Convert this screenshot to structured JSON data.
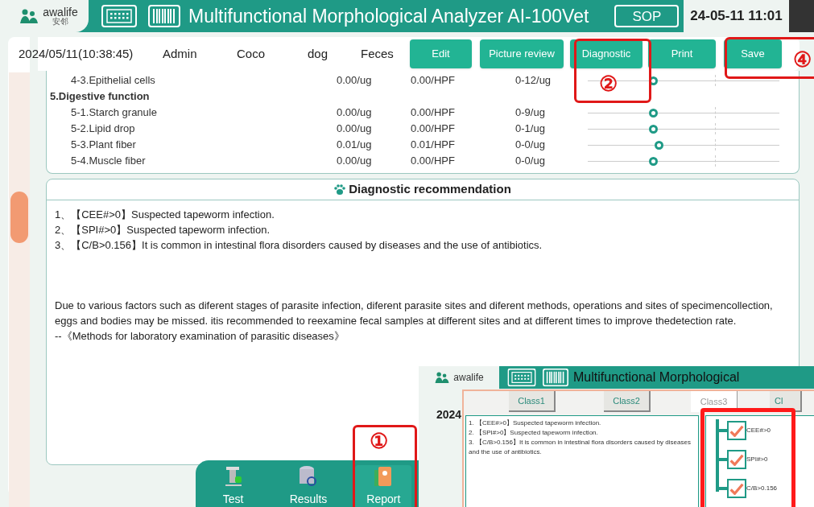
{
  "header": {
    "logo": "awalife",
    "logo_sub": "安邻",
    "title": "Multifunctional Morphological Analyzer AI-100Vet",
    "sop": "SOP",
    "datetime": "24-05-11 11:01"
  },
  "info": {
    "fields": [
      "2024/05/11(10:38:45)",
      "Admin",
      "Coco",
      "dog",
      "Feces"
    ],
    "buttons": [
      "Edit",
      "Picture review",
      "Diagnostic",
      "Print",
      "Save"
    ]
  },
  "table": {
    "rows": [
      {
        "kind": "item",
        "name": "4-3.Epithelial cells",
        "value": "0.00/ug",
        "hpf": "0.00/HPF",
        "range": "0-12/ug",
        "level": 0.34
      },
      {
        "kind": "heading",
        "name": "5.Digestive function"
      },
      {
        "kind": "item",
        "name": "5-1.Starch granule",
        "value": "0.00/ug",
        "hpf": "0.00/HPF",
        "range": "0-9/ug",
        "level": 0.34
      },
      {
        "kind": "item",
        "name": "5-2.Lipid drop",
        "value": "0.00/ug",
        "hpf": "0.00/HPF",
        "range": "0-1/ug",
        "level": 0.34
      },
      {
        "kind": "item",
        "name": "5-3.Plant fiber",
        "value": "0.01/ug",
        "hpf": "0.01/HPF",
        "range": "0-0/ug",
        "level": 0.37
      },
      {
        "kind": "item",
        "name": "5-4.Muscle fiber",
        "value": "0.00/ug",
        "hpf": "0.00/HPF",
        "range": "0-0/ug",
        "level": 0.34
      }
    ]
  },
  "recommendation": {
    "title": "Diagnostic recommendation",
    "items": [
      "1、【CEE#>0】Suspected tapeworm infection.",
      "2、【SPI#>0】Suspected tapeworm infection.",
      "3、【C/B>0.156】It is common in intestinal flora disorders caused by diseases and the use of antibiotics."
    ],
    "note": "Due to various factors such as diferent stages of parasite infection, diferent parasite sites and diferent methods, operations and sites of specimencollection, eggs and bodies may be missed. itis recommended to reexamine fecal samples at different sites and at different times to improve thedetection rate.",
    "source": "--《Methods for laboratory examination of parasitic diseases》"
  },
  "nav": [
    {
      "label": "Test",
      "selected": false
    },
    {
      "label": "Results",
      "selected": false
    },
    {
      "label": "Report",
      "selected": true
    }
  ],
  "annotations": [
    "①",
    "②",
    "④"
  ],
  "inset": {
    "logo": "awalife",
    "title": "Multifunctional Morphological",
    "date_fragment": "2024",
    "tabs": [
      {
        "label": "Class1",
        "selected": false
      },
      {
        "label": "Class2",
        "selected": false
      },
      {
        "label": "Class3",
        "selected": true
      },
      {
        "label": "Cl",
        "selected": false
      }
    ],
    "items": [
      "1.  【CEE#>0】Suspected tapeworm infection.",
      "2.  【SPI#>0】Suspected tapeworm infection.",
      "3.  【C/B>0.156】It is common in intestinal flora disorders caused by diseases and the use of antibiotics."
    ],
    "checks": [
      {
        "label": "CEE#>0",
        "checked": true
      },
      {
        "label": "SPI#>0",
        "checked": true
      },
      {
        "label": "C/B>0.156",
        "checked": true
      }
    ]
  }
}
